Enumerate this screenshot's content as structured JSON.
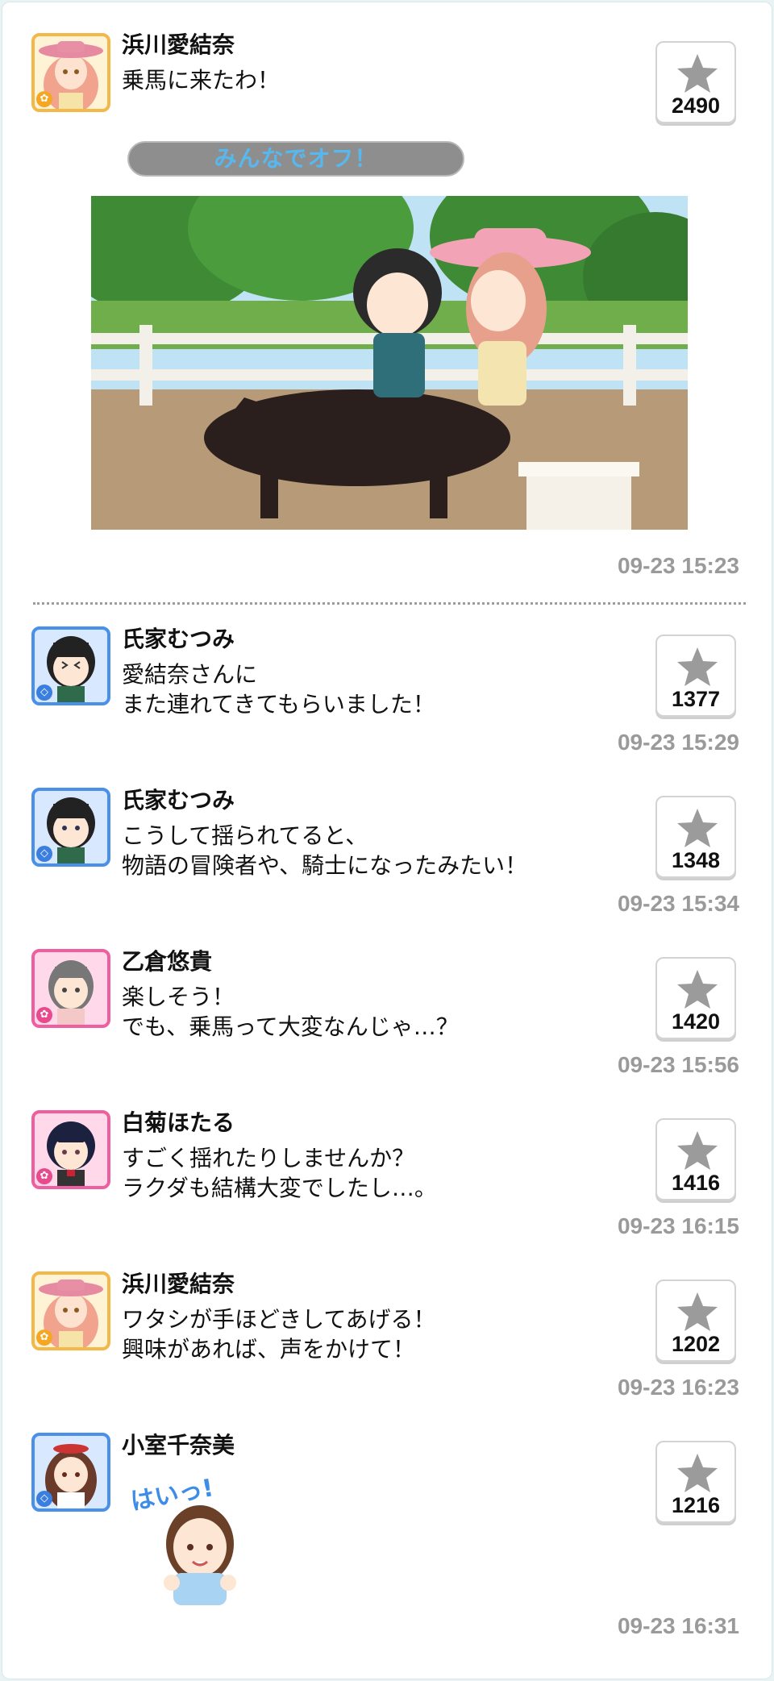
{
  "banner": {
    "text": "みんなでオフ！"
  },
  "posts": [
    {
      "name": "浜川愛結奈",
      "lines": [
        "乗馬に来たわ！"
      ],
      "likes": "2490",
      "time": "09-23 15:23",
      "avatar_color": "#f3b84a"
    },
    {
      "name": "氏家むつみ",
      "lines": [
        "愛結奈さんに",
        "また連れてきてもらいました！"
      ],
      "likes": "1377",
      "time": "09-23 15:29",
      "avatar_color": "#4a8fe8"
    },
    {
      "name": "氏家むつみ",
      "lines": [
        "こうして揺られてると、",
        "物語の冒険者や、騎士になったみたい！"
      ],
      "likes": "1348",
      "time": "09-23 15:34",
      "avatar_color": "#4a8fe8"
    },
    {
      "name": "乙倉悠貴",
      "lines": [
        "楽しそう！",
        "でも、乗馬って大変なんじゃ…？"
      ],
      "likes": "1420",
      "time": "09-23 15:56",
      "avatar_color": "#ee5fa0"
    },
    {
      "name": "白菊ほたる",
      "lines": [
        "すごく揺れたりしませんか？",
        "ラクダも結構大変でしたし…。"
      ],
      "likes": "1416",
      "time": "09-23 16:15",
      "avatar_color": "#ee5fa0"
    },
    {
      "name": "浜川愛結奈",
      "lines": [
        "ワタシが手ほどきしてあげる！",
        "興味があれば、声をかけて！"
      ],
      "likes": "1202",
      "time": "09-23 16:23",
      "avatar_color": "#f3b84a"
    },
    {
      "name": "小室千奈美",
      "lines": [],
      "likes": "1216",
      "time": "09-23 16:31",
      "avatar_color": "#4a8fe8"
    }
  ],
  "stamp": {
    "text": "はいっ!"
  },
  "icons": {
    "like": "star-icon",
    "type_badge": "attribute-badge-icon"
  },
  "colors": {
    "star": "#9b9b9b",
    "time": "#9a9a9a",
    "banner_text": "#57b8f0",
    "banner_bg": "#8e8e8e"
  }
}
